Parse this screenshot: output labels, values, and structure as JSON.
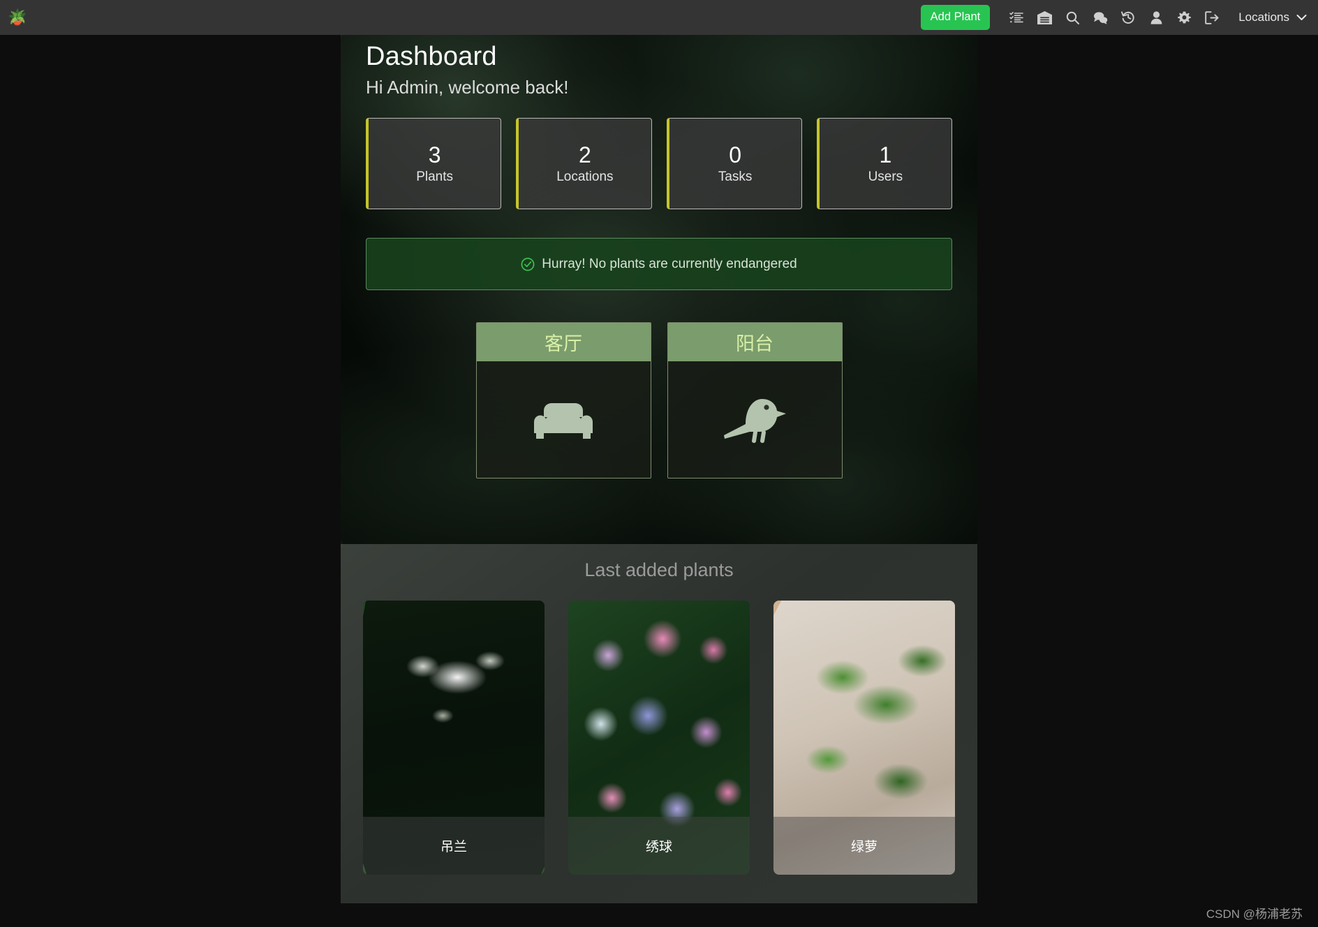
{
  "navbar": {
    "brand_icon": "potted-plant-logo",
    "add_plant_label": "Add Plant",
    "icons": [
      {
        "name": "tasks-list-icon",
        "title": "Tasks"
      },
      {
        "name": "warehouse-icon",
        "title": "Locations"
      },
      {
        "name": "search-icon",
        "title": "Search"
      },
      {
        "name": "comments-icon",
        "title": "Comments"
      },
      {
        "name": "history-icon",
        "title": "History"
      },
      {
        "name": "user-icon",
        "title": "User"
      },
      {
        "name": "gear-icon",
        "title": "Settings"
      },
      {
        "name": "logout-icon",
        "title": "Logout"
      }
    ],
    "dropdown_label": "Locations",
    "dropdown_caret": "chevron-down-icon",
    "accent_green": "#28c452",
    "bar_background": "#343434"
  },
  "header": {
    "title": "Dashboard",
    "welcome": "Hi Admin, welcome back!"
  },
  "stats": [
    {
      "value": "3",
      "label": "Plants"
    },
    {
      "value": "2",
      "label": "Locations"
    },
    {
      "value": "0",
      "label": "Tasks"
    },
    {
      "value": "1",
      "label": "Users"
    }
  ],
  "stat_card_style": {
    "left_border_color": "#c6c52b",
    "border_color": "#b9b9b9"
  },
  "alert": {
    "icon": "check-circle-icon",
    "text": "Hurray! No plants are currently endangered",
    "background": "#18421c",
    "icon_color": "#3fbf55"
  },
  "locations": [
    {
      "name": "客厅",
      "icon": "couch-icon"
    },
    {
      "name": "阳台",
      "icon": "bird-icon"
    }
  ],
  "location_style": {
    "header_background": "#7b9c6c",
    "header_text_color": "#d9f0a8",
    "icon_color": "#b4c3ae"
  },
  "last_added": {
    "title": "Last added plants",
    "plants": [
      {
        "name": "吊兰",
        "image": "spider-plant-photo"
      },
      {
        "name": "绣球",
        "image": "hydrangea-photo"
      },
      {
        "name": "绿萝",
        "image": "pothos-photo"
      }
    ]
  },
  "watermark": {
    "text": "CSDN @杨浦老苏"
  }
}
